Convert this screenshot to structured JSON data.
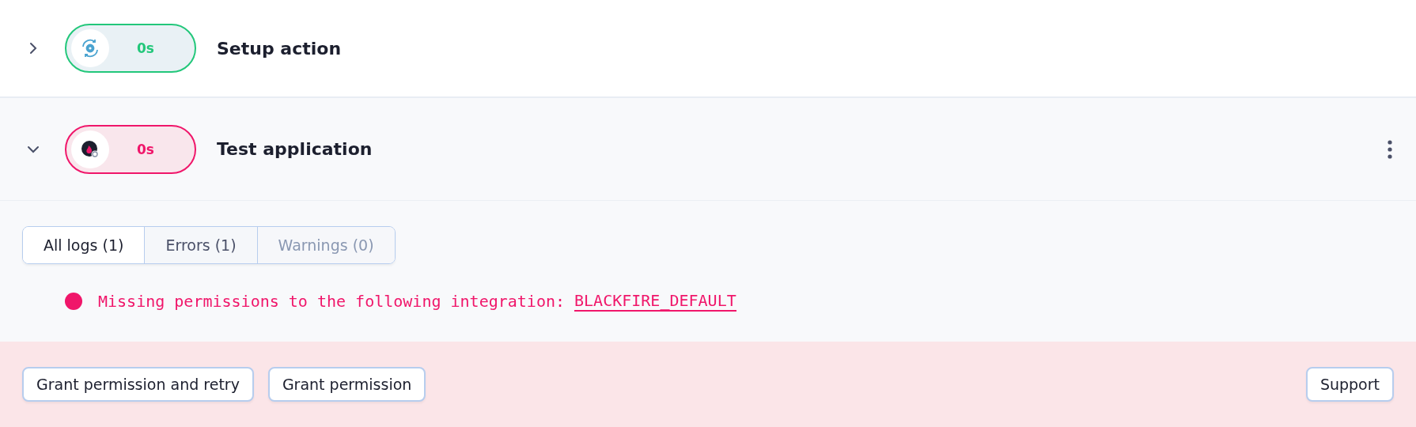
{
  "steps": [
    {
      "name": "Setup action",
      "duration": "0s",
      "kind": "success",
      "expanded": false,
      "menu": false
    },
    {
      "name": "Test application",
      "duration": "0s",
      "kind": "failure",
      "expanded": true,
      "menu": true
    }
  ],
  "log_tabs": [
    {
      "label": "All logs (1)",
      "selected": true,
      "disabled": false
    },
    {
      "label": "Errors (1)",
      "selected": false,
      "disabled": false
    },
    {
      "label": "Warnings (0)",
      "selected": false,
      "disabled": true
    }
  ],
  "logs": [
    {
      "color": "#f0166a",
      "text": "Missing permissions to the following integration:",
      "link": "BLACKFIRE_DEFAULT"
    }
  ],
  "actions": [
    "Grant permission and retry",
    "Grant permission"
  ],
  "support_button": "Support"
}
